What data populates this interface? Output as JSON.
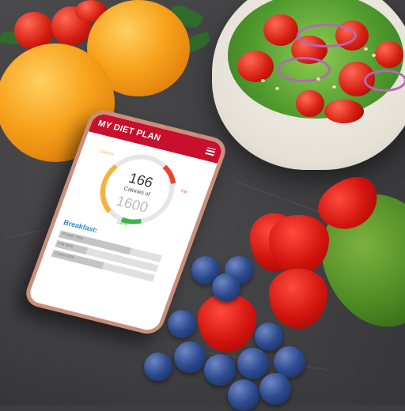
{
  "app": {
    "title": "MY DIET PLAN",
    "menu_icon": "hamburger-icon",
    "accent_color": "#c8102e"
  },
  "gauge": {
    "consumed": "166",
    "unit_text": "Calories of",
    "target": "1600",
    "segment_labels": {
      "left": "Calories",
      "right": "Fat",
      "bottom": "Carbs"
    },
    "segment_colors": {
      "left": "#f2b33d",
      "right": "#e8452c",
      "bottom": "#3bb54a"
    }
  },
  "meal": {
    "title": "Breakfast:",
    "items": [
      {
        "label": "Protein 70%",
        "progress": 0.7
      },
      {
        "label": "Fat 30%",
        "progress": 0.3
      },
      {
        "label": "Carbs 50%",
        "progress": 0.5
      }
    ]
  }
}
